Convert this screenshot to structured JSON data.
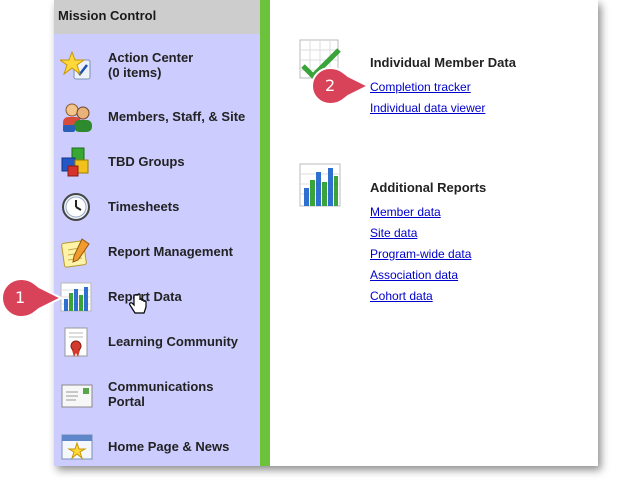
{
  "sidebar": {
    "title": "Mission Control",
    "items": [
      {
        "label": "Action Center",
        "sublabel": "(0 items)",
        "icon": "star-clipboard-icon"
      },
      {
        "label": "Members, Staff, & Site",
        "icon": "people-icon"
      },
      {
        "label": "TBD Groups",
        "icon": "cubes-icon"
      },
      {
        "label": "Timesheets",
        "icon": "clock-icon"
      },
      {
        "label": "Report Management",
        "icon": "notepad-pencil-icon"
      },
      {
        "label": "Report Data",
        "icon": "bar-chart-icon"
      },
      {
        "label": "Learning Community",
        "icon": "certificate-icon"
      },
      {
        "label": "Communications",
        "sublabel": "Portal",
        "icon": "envelope-icon"
      },
      {
        "label": "Home Page & News",
        "icon": "browser-star-icon"
      }
    ]
  },
  "content": {
    "sections": [
      {
        "title": "Individual Member Data",
        "icon": "chart-checkmark-icon",
        "links": [
          "Completion tracker",
          "Individual data viewer"
        ]
      },
      {
        "title": "Additional Reports",
        "icon": "bar-chart-icon",
        "links": [
          "Member data",
          "Site data",
          "Program-wide data",
          "Association data",
          "Cohort data"
        ]
      }
    ]
  },
  "callouts": [
    {
      "number": "1"
    },
    {
      "number": "2"
    }
  ],
  "colors": {
    "sidebar_bg": "#ccccff",
    "header_bg": "#cdcdcd",
    "accent_green": "#6cc23a",
    "link": "#0000cc",
    "badge": "#d9435a"
  }
}
